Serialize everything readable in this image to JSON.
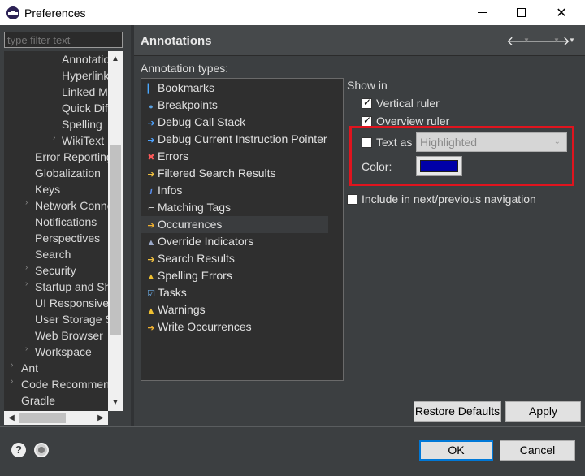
{
  "window": {
    "title": "Preferences"
  },
  "filter": {
    "placeholder": "type filter text"
  },
  "tree": {
    "items": [
      {
        "label": "Annotations",
        "level": 3
      },
      {
        "label": "Hyperlinking",
        "level": 3
      },
      {
        "label": "Linked Mode",
        "level": 3
      },
      {
        "label": "Quick Diff",
        "level": 3
      },
      {
        "label": "Spelling",
        "level": 3
      },
      {
        "label": "WikiText",
        "level": 3,
        "expandable": true
      },
      {
        "label": "Error Reporting",
        "level": 2
      },
      {
        "label": "Globalization",
        "level": 2
      },
      {
        "label": "Keys",
        "level": 2
      },
      {
        "label": "Network Connections",
        "level": 2,
        "expandable": true
      },
      {
        "label": "Notifications",
        "level": 2
      },
      {
        "label": "Perspectives",
        "level": 2
      },
      {
        "label": "Search",
        "level": 2
      },
      {
        "label": "Security",
        "level": 2,
        "expandable": true
      },
      {
        "label": "Startup and Shutdown",
        "level": 2,
        "expandable": true
      },
      {
        "label": "UI Responsiveness",
        "level": 2
      },
      {
        "label": "User Storage Service",
        "level": 2
      },
      {
        "label": "Web Browser",
        "level": 2
      },
      {
        "label": "Workspace",
        "level": 2,
        "expandable": true
      },
      {
        "label": "Ant",
        "level": 1,
        "expandable": true
      },
      {
        "label": "Code Recommenders",
        "level": 1,
        "expandable": true
      },
      {
        "label": "Gradle",
        "level": 1
      }
    ]
  },
  "page": {
    "title": "Annotations",
    "annotation_types_label": "Annotation types:",
    "annotation_types": [
      {
        "label": "Bookmarks",
        "icon": "bookmark-icon"
      },
      {
        "label": "Breakpoints",
        "icon": "breakpoint-icon"
      },
      {
        "label": "Debug Call Stack",
        "icon": "debug-arrow-icon"
      },
      {
        "label": "Debug Current Instruction Pointer",
        "icon": "debug-arrow-icon"
      },
      {
        "label": "Errors",
        "icon": "error-icon"
      },
      {
        "label": "Filtered Search Results",
        "icon": "search-result-icon"
      },
      {
        "label": "Infos",
        "icon": "info-icon"
      },
      {
        "label": "Matching Tags",
        "icon": "tag-icon"
      },
      {
        "label": "Occurrences",
        "icon": "occurrence-icon",
        "selected": true
      },
      {
        "label": "Override Indicators",
        "icon": "override-icon"
      },
      {
        "label": "Search Results",
        "icon": "search-result-icon"
      },
      {
        "label": "Spelling Errors",
        "icon": "warning-icon"
      },
      {
        "label": "Tasks",
        "icon": "task-icon"
      },
      {
        "label": "Warnings",
        "icon": "warning-icon"
      },
      {
        "label": "Write Occurrences",
        "icon": "occurrence-icon"
      }
    ],
    "show_in_label": "Show in",
    "vertical_ruler": {
      "label": "Vertical ruler",
      "checked": true
    },
    "overview_ruler": {
      "label": "Overview ruler",
      "checked": true
    },
    "text_as": {
      "label": "Text as",
      "checked": false,
      "value": "Highlighted"
    },
    "color_label": "Color:",
    "color_value": "#0000a8",
    "include_nav": {
      "label": "Include in next/previous navigation",
      "checked": false
    },
    "restore_defaults": "Restore Defaults",
    "apply": "Apply"
  },
  "footer": {
    "ok": "OK",
    "cancel": "Cancel"
  }
}
